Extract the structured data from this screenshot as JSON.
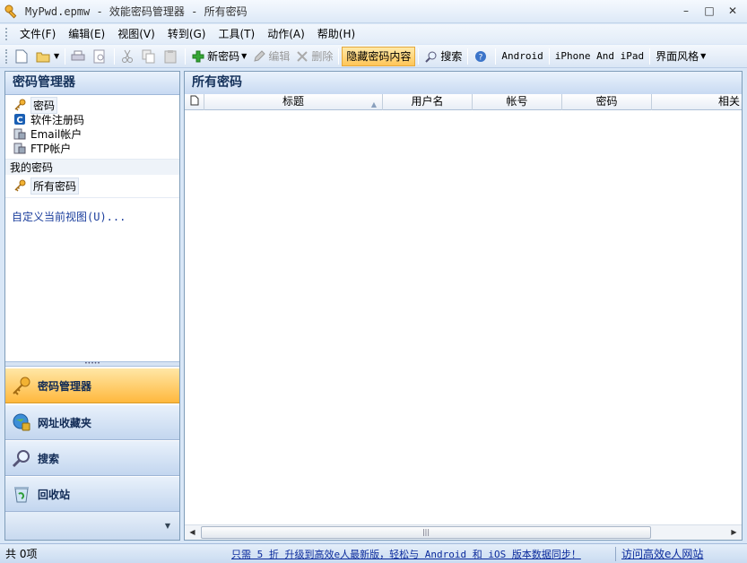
{
  "window": {
    "title": "MyPwd.epmw - 效能密码管理器 - 所有密码",
    "controls": [
      "–",
      "□",
      "✕"
    ]
  },
  "menu": {
    "items": [
      "文件(F)",
      "编辑(E)",
      "视图(V)",
      "转到(G)",
      "工具(T)",
      "动作(A)",
      "帮助(H)"
    ]
  },
  "toolbar": {
    "new_password": "新密码",
    "edit": "编辑",
    "delete": "删除",
    "hide_content": "隐藏密码内容",
    "search": "搜索",
    "android": "Android",
    "iphone": "iPhone And iPad",
    "skin": "界面风格"
  },
  "left_pane": {
    "header": "密码管理器",
    "categories": [
      "密码",
      "软件注册码",
      "Email帐户",
      "FTP帐户"
    ],
    "group_label": "我的密码",
    "group_items": [
      "所有密码"
    ],
    "custom_view": "自定义当前视图(U)..."
  },
  "nav_buttons": [
    "密码管理器",
    "网址收藏夹",
    "搜索",
    "回收站"
  ],
  "right_pane": {
    "header": "所有密码",
    "columns": [
      "标题",
      "用户名",
      "帐号",
      "密码",
      "相关"
    ]
  },
  "statusbar": {
    "count": "共 0项",
    "promo": "只需 5 折 升级到高效e人最新版，轻松与 Android 和 iOS 版本数据同步！",
    "link": "访问高效e人网站"
  },
  "colors": {
    "accent_active": "#ffb83d",
    "header_text": "#15325b",
    "link": "#0a2a9c"
  }
}
